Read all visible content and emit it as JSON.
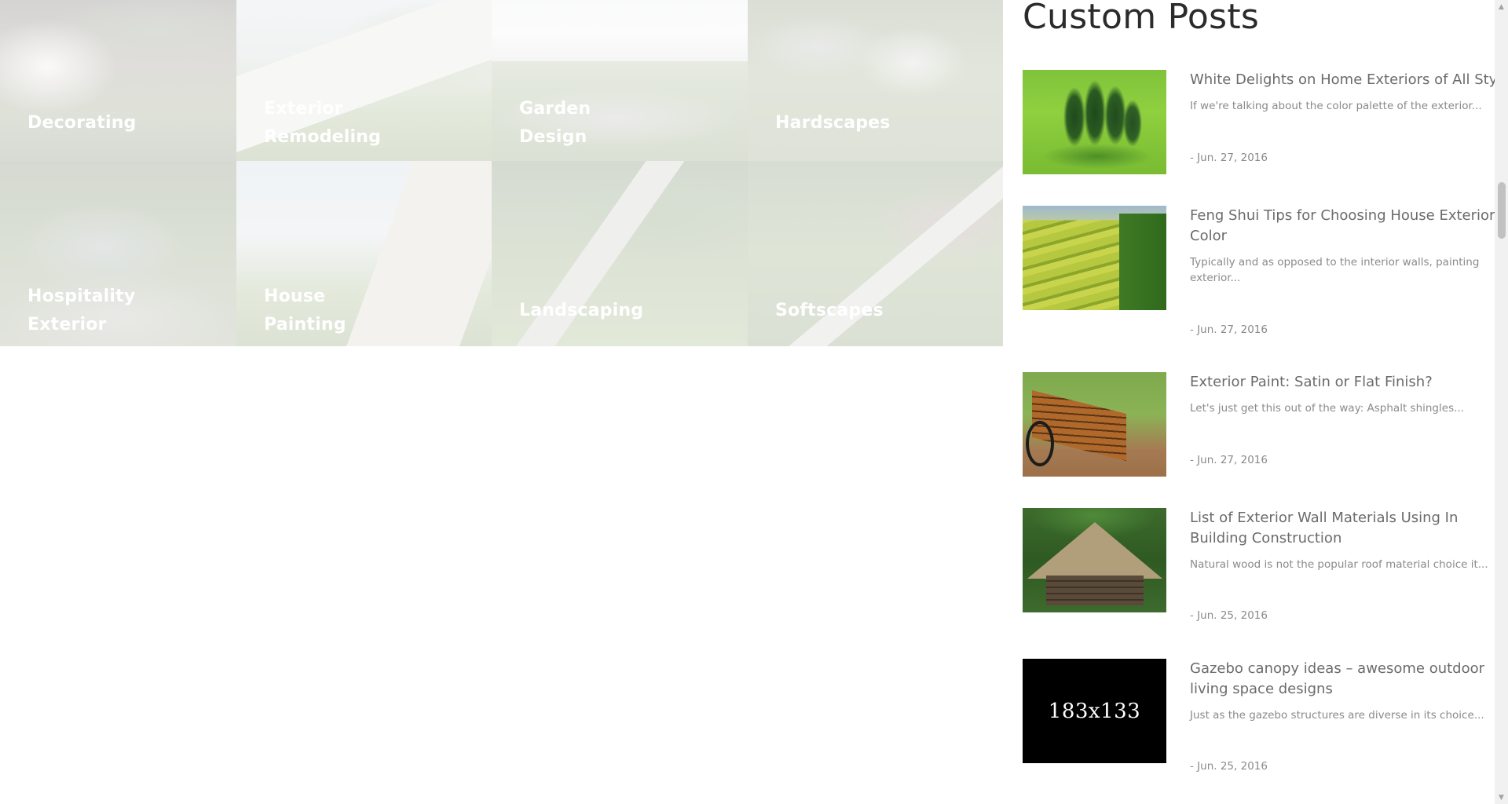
{
  "categories": [
    {
      "label": "Decorating"
    },
    {
      "label": "Exterior Remodeling"
    },
    {
      "label": "Garden Design"
    },
    {
      "label": "Hardscapes"
    },
    {
      "label": "Hospitality Exterior"
    },
    {
      "label": "House Painting"
    },
    {
      "label": "Landscaping"
    },
    {
      "label": "Softscapes"
    }
  ],
  "sidebar": {
    "title": "Custom Posts",
    "posts": [
      {
        "title": "White Delights on Home Exteriors of All Styles",
        "excerpt": "If we're talking about the color palette of the exterior...",
        "date": "- Jun. 27, 2016"
      },
      {
        "title": "Feng Shui Tips for Choosing House Exterior Color",
        "excerpt": "Typically and as opposed to the interior walls, painting exterior...",
        "date": "- Jun. 27, 2016"
      },
      {
        "title": "Exterior Paint: Satin or Flat Finish?",
        "excerpt": "Let's just get this out of the way: Asphalt shingles...",
        "date": "- Jun. 27, 2016"
      },
      {
        "title": "List of Exterior Wall Materials Using In Building Construction",
        "excerpt": "Natural wood is not the popular roof material choice it...",
        "date": "- Jun. 25, 2016"
      },
      {
        "title": "Gazebo canopy ideas – awesome outdoor living space designs",
        "excerpt": "Just as the gazebo structures are diverse in its choice...",
        "date": "- Jun. 25, 2016",
        "thumb_text": "183x133"
      }
    ]
  },
  "icons": {
    "scroll_up": "scroll-up-arrow-icon",
    "scroll_down": "scroll-down-arrow-icon"
  }
}
